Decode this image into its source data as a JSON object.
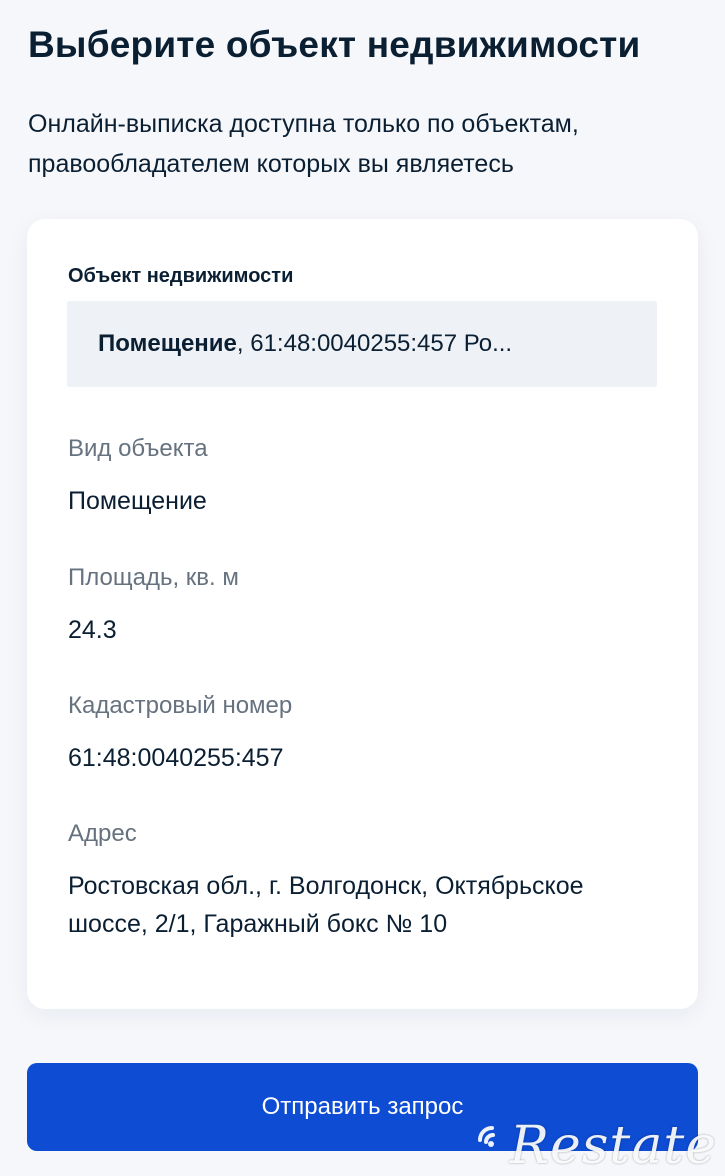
{
  "header": {
    "title": "Выберите объект недвижимости",
    "subtitle": "Онлайн-выписка доступна только по объектам, правообладателем которых вы являетесь"
  },
  "card": {
    "object_label": "Объект недвижимости",
    "selected": {
      "type_bold": "Помещение",
      "rest": ", 61:48:0040255:457 Ро..."
    },
    "details": [
      {
        "label": "Вид объекта",
        "value": "Помещение"
      },
      {
        "label": "Площадь, кв. м",
        "value": "24.3"
      },
      {
        "label": "Кадастровый номер",
        "value": "61:48:0040255:457"
      },
      {
        "label": "Адрес",
        "value": "Ростовская обл., г. Волгодонск, Октябрьское шоссе, 2/1, Гаражный бокс № 10"
      }
    ]
  },
  "actions": {
    "submit_label": "Отправить запрос"
  },
  "watermark": {
    "text": "Restate",
    "icon": "wifi-signal-icon"
  },
  "colors": {
    "primary_button": "#0d4cd3",
    "background": "#f5f7fb",
    "card": "#ffffff",
    "select_background": "#eef1f6",
    "muted_text": "#66727f",
    "text": "#0b1f33"
  }
}
